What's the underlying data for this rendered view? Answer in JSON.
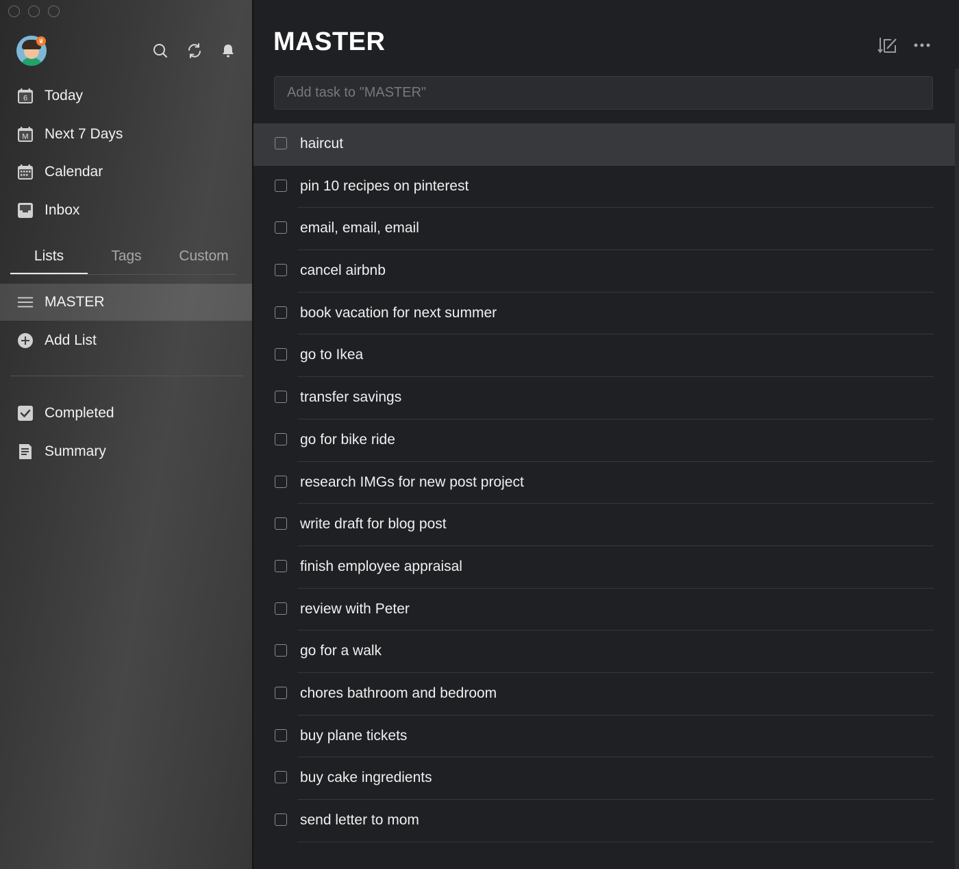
{
  "sidebar": {
    "top_icons": [
      "search-icon",
      "sync-icon",
      "bell-icon"
    ],
    "nav": [
      {
        "label": "Today",
        "icon": "calendar-today-icon",
        "badge": "6"
      },
      {
        "label": "Next 7 Days",
        "icon": "calendar-week-icon",
        "badge": "M"
      },
      {
        "label": "Calendar",
        "icon": "calendar-grid-icon"
      },
      {
        "label": "Inbox",
        "icon": "inbox-icon"
      }
    ],
    "tabs": [
      {
        "label": "Lists",
        "active": true
      },
      {
        "label": "Tags",
        "active": false
      },
      {
        "label": "Custom",
        "active": false
      }
    ],
    "lists": [
      {
        "label": "MASTER",
        "icon": "hamburger-icon",
        "selected": true
      },
      {
        "label": "Add List",
        "icon": "plus-circle-icon",
        "selected": false
      }
    ],
    "bottom": [
      {
        "label": "Completed",
        "icon": "checkbox-checked-icon"
      },
      {
        "label": "Summary",
        "icon": "document-icon"
      }
    ]
  },
  "main": {
    "title": "MASTER",
    "add_task_placeholder": "Add task to \"MASTER\"",
    "header_icons": [
      "sort-edit-icon",
      "more-icon"
    ],
    "tasks": [
      {
        "text": "haircut",
        "highlighted": true
      },
      {
        "text": "pin 10 recipes on pinterest"
      },
      {
        "text": "email, email, email"
      },
      {
        "text": "cancel airbnb"
      },
      {
        "text": "book vacation for next summer"
      },
      {
        "text": "go to Ikea"
      },
      {
        "text": "transfer savings"
      },
      {
        "text": "go for bike ride"
      },
      {
        "text": "research IMGs for new post project"
      },
      {
        "text": "write draft for blog post"
      },
      {
        "text": "finish employee appraisal"
      },
      {
        "text": "review with Peter"
      },
      {
        "text": "go for a walk"
      },
      {
        "text": "chores bathroom and bedroom"
      },
      {
        "text": "buy plane tickets"
      },
      {
        "text": "buy cake ingredients"
      },
      {
        "text": "send letter to mom"
      }
    ]
  },
  "colors": {
    "sidebar_bg": "#3a3a3b",
    "main_bg": "#1f2023",
    "text": "#f0f0f0",
    "muted": "#a8a8a8",
    "selected_row": "#38393c"
  }
}
